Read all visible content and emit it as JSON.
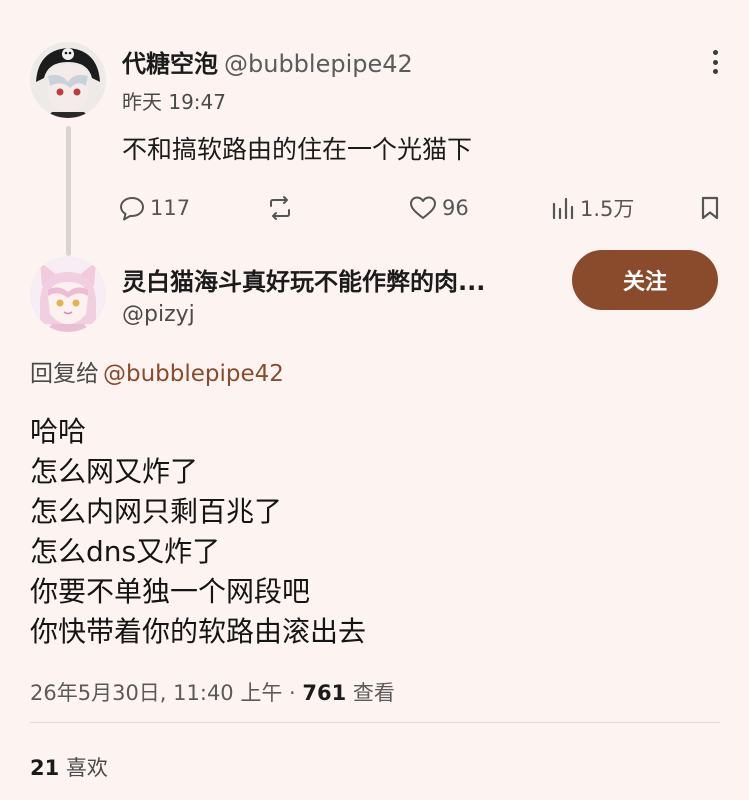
{
  "parent_post": {
    "display_name": "代糖空泡",
    "handle": "@bubblepipe42",
    "time": "昨天 19:47",
    "text": "不和搞软路由的住在一个光猫下",
    "stats": {
      "replies": "117",
      "likes": "96",
      "views": "1.5万"
    },
    "icons": {
      "reply": "speech-bubble-icon",
      "repost": "repost-arrows-icon",
      "like": "heart-icon",
      "views": "bar-chart-icon",
      "bookmark": "bookmark-icon",
      "more": "vertical-ellipsis-icon"
    }
  },
  "reply_post": {
    "display_name": "灵白猫海斗真好玩不能作弊的肉...",
    "handle": "@pizyj",
    "follow_label": "关注",
    "reply_to_label": "回复给",
    "reply_to_handle": "@bubblepipe42",
    "lines": [
      "哈哈",
      "怎么网又炸了",
      "怎么内网只剩百兆了",
      "怎么dns又炸了",
      "你要不单独一个网段吧",
      "你快带着你的软路由滚出去"
    ],
    "timestamp": "26年5月30日, 11:40 上午 · ",
    "views_count": "761",
    "views_label": " 查看",
    "likes_count": "21",
    "likes_label": " 喜欢"
  },
  "colors": {
    "background": "#fdf4f2",
    "accent": "#8a4b2c",
    "text": "#1b1b1b",
    "muted": "#5a5a5a"
  }
}
